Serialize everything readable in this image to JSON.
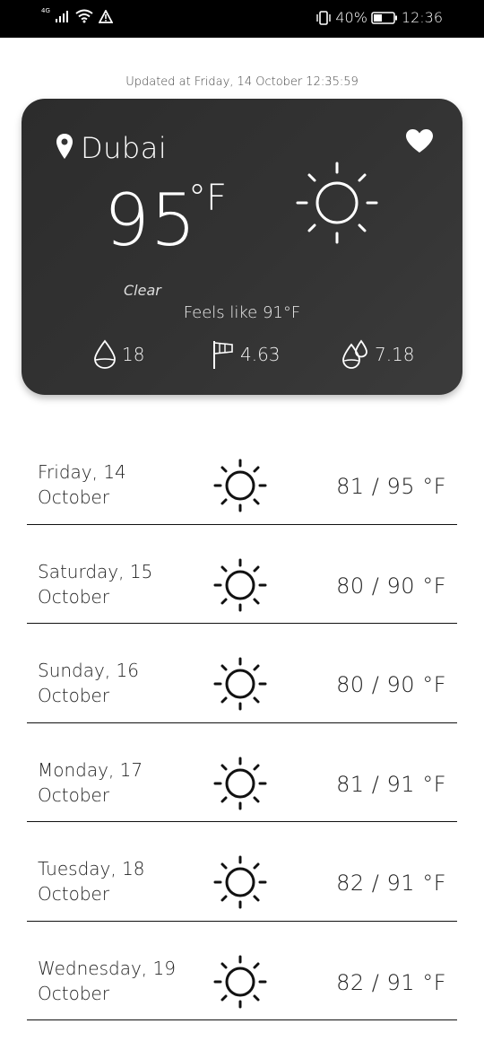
{
  "status_bar": {
    "network": "4G",
    "battery_percent": "40%",
    "time": "12:36"
  },
  "updated_text": "Updated at Friday, 14 October 12:35:59",
  "current": {
    "city": "Dubai",
    "temperature": "95",
    "unit": "°F",
    "condition": "Clear",
    "feels_like": "Feels like 91°F",
    "humidity": "18",
    "wind": "4.63",
    "precipitation": "7.18",
    "icons": {
      "location": "location-pin-icon",
      "favorite": "heart-icon",
      "weather": "sun-icon",
      "humidity": "water-drop-icon",
      "wind": "wind-flag-icon",
      "precipitation": "rain-drops-icon"
    }
  },
  "forecast": [
    {
      "day": "Friday, 14",
      "month": "October",
      "range": "81 / 95 °F",
      "icon": "sun-icon"
    },
    {
      "day": "Saturday, 15",
      "month": "October",
      "range": "80 / 90 °F",
      "icon": "sun-icon"
    },
    {
      "day": "Sunday, 16",
      "month": "October",
      "range": "80 / 90 °F",
      "icon": "sun-icon"
    },
    {
      "day": "Monday, 17",
      "month": "October",
      "range": "81 / 91 °F",
      "icon": "sun-icon"
    },
    {
      "day": "Tuesday, 18",
      "month": "October",
      "range": "82 / 91 °F",
      "icon": "sun-icon"
    },
    {
      "day": "Wednesday, 19",
      "month": "October",
      "range": "82 / 91 °F",
      "icon": "sun-icon"
    }
  ],
  "colors": {
    "card_background": "#333333",
    "status_bar": "#000000",
    "divider": "#111111"
  }
}
